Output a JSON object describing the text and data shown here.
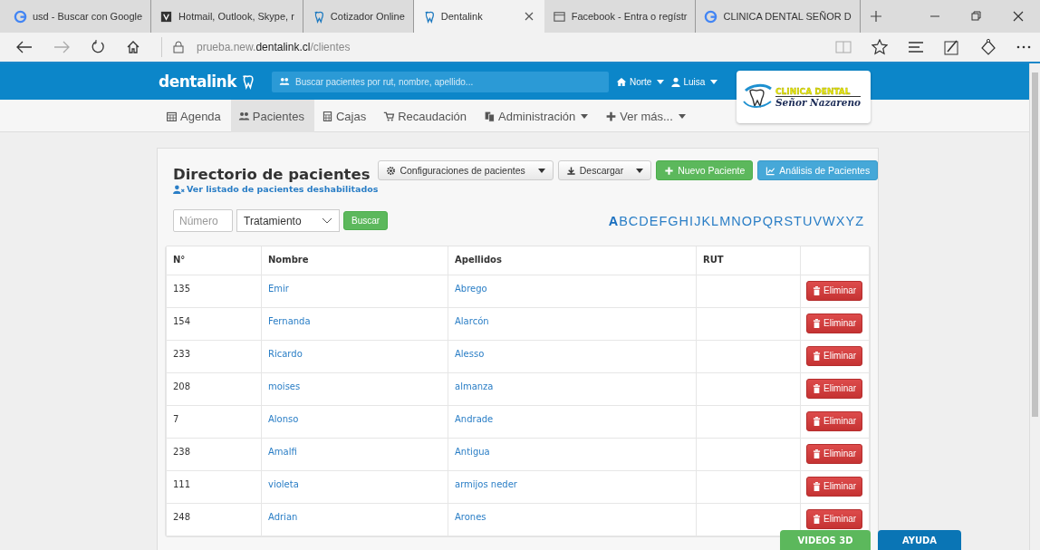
{
  "browser": {
    "tabs": [
      {
        "label": "usd - Buscar con Google",
        "selected": false
      },
      {
        "label": "Hotmail, Outlook, Skype, r",
        "selected": false
      },
      {
        "label": "Cotizador Online",
        "selected": false
      },
      {
        "label": "Dentalink",
        "selected": true
      },
      {
        "label": "Facebook - Entra o regístr",
        "selected": false
      },
      {
        "label": "CLINICA DENTAL SEÑOR D",
        "selected": false
      }
    ],
    "url": {
      "prefix": "prueba.new.",
      "domain": "dentalink.cl",
      "path": "/clientes"
    }
  },
  "header": {
    "logo": "dentalink",
    "search_placeholder": "Buscar pacientes por rut, nombre, apellido...",
    "branch": "Norte",
    "user": "Luisa",
    "clinic": {
      "line1": "CLINICA DENTAL",
      "line2": "Señor Nazareno"
    }
  },
  "nav": [
    {
      "label": "Agenda",
      "dropdown": false,
      "selected": false
    },
    {
      "label": "Pacientes",
      "dropdown": false,
      "selected": true
    },
    {
      "label": "Cajas",
      "dropdown": false,
      "selected": false
    },
    {
      "label": "Recaudación",
      "dropdown": false,
      "selected": false
    },
    {
      "label": "Administración",
      "dropdown": true,
      "selected": false
    },
    {
      "label": "Ver más...",
      "dropdown": true,
      "selected": false
    }
  ],
  "panel": {
    "title": "Directorio de pacientes",
    "disabled_link": "Ver listado de pacientes deshabilitados",
    "actions": [
      {
        "label": "Configuraciones de pacientes",
        "kind": "default",
        "dropdown": true
      },
      {
        "label": "Descargar",
        "kind": "default",
        "dropdown": true
      },
      {
        "label": "Nuevo Paciente",
        "kind": "success",
        "dropdown": false
      },
      {
        "label": "Análisis de Pacientes",
        "kind": "info",
        "dropdown": false
      }
    ],
    "number_placeholder": "Número",
    "treatment": "Tratamiento",
    "search_button": "Buscar",
    "letters": [
      {
        "label": "A",
        "selected": true
      },
      {
        "label": "B",
        "selected": false
      },
      {
        "label": "C",
        "selected": false
      },
      {
        "label": "D",
        "selected": false
      },
      {
        "label": "E",
        "selected": false
      },
      {
        "label": "F",
        "selected": false
      },
      {
        "label": "G",
        "selected": false
      },
      {
        "label": "H",
        "selected": false
      },
      {
        "label": "I",
        "selected": false
      },
      {
        "label": "J",
        "selected": false
      },
      {
        "label": "K",
        "selected": false
      },
      {
        "label": "L",
        "selected": false
      },
      {
        "label": "M",
        "selected": false
      },
      {
        "label": "N",
        "selected": false
      },
      {
        "label": "O",
        "selected": false
      },
      {
        "label": "P",
        "selected": false
      },
      {
        "label": "Q",
        "selected": false
      },
      {
        "label": "R",
        "selected": false
      },
      {
        "label": "S",
        "selected": false
      },
      {
        "label": "T",
        "selected": false
      },
      {
        "label": "U",
        "selected": false
      },
      {
        "label": "V",
        "selected": false
      },
      {
        "label": "W",
        "selected": false
      },
      {
        "label": "X",
        "selected": false
      },
      {
        "label": "Y",
        "selected": false
      },
      {
        "label": "Z",
        "selected": false
      }
    ]
  },
  "table": {
    "columns": [
      "N°",
      "Nombre",
      "Apellidos",
      "RUT"
    ],
    "rows": [
      {
        "number": "135",
        "name": "Emir",
        "surname": "Abrego",
        "delete": "Eliminar"
      },
      {
        "number": "154",
        "name": "Fernanda",
        "surname": "Alarcón",
        "delete": "Eliminar"
      },
      {
        "number": "233",
        "name": "Ricardo",
        "surname": "Alesso",
        "delete": "Eliminar"
      },
      {
        "number": "208",
        "name": "moises",
        "surname": "almanza",
        "delete": "Eliminar"
      },
      {
        "number": "7",
        "name": "Alonso",
        "surname": "Andrade",
        "delete": "Eliminar"
      },
      {
        "number": "238",
        "name": "Amalfi",
        "surname": "Antigua",
        "delete": "Eliminar"
      },
      {
        "number": "111",
        "name": "violeta",
        "surname": "armijos neder",
        "delete": "Eliminar"
      },
      {
        "number": "248",
        "name": "Adrian",
        "surname": "Arones",
        "delete": "Eliminar"
      }
    ]
  },
  "floating": [
    {
      "label": "VIDEOS 3D",
      "kind": "success"
    },
    {
      "label": "AYUDA",
      "kind": "primary"
    }
  ]
}
